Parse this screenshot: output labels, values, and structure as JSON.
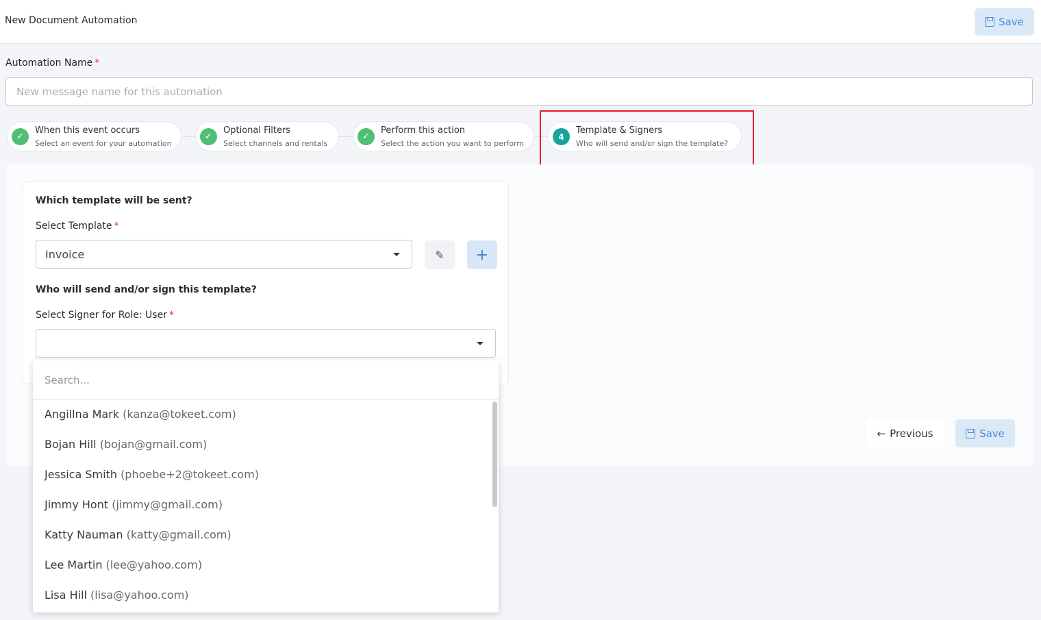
{
  "header": {
    "title": "New Document Automation",
    "save_label": "Save"
  },
  "automation_name": {
    "label": "Automation Name",
    "required_mark": "*",
    "placeholder": "New message name for this automation",
    "value": ""
  },
  "steps": [
    {
      "title": "When this event occurs",
      "subtitle": "Select an event for your automation",
      "status": "complete",
      "icon": "check-icon"
    },
    {
      "title": "Optional Filters",
      "subtitle": "Select channels and rentals",
      "status": "complete",
      "icon": "check-icon"
    },
    {
      "title": "Perform this action",
      "subtitle": "Select the action you want to perform",
      "status": "complete",
      "icon": "check-icon"
    },
    {
      "number": "4",
      "title": "Template & Signers",
      "subtitle": "Who will send and/or sign the template?",
      "status": "active"
    }
  ],
  "template_card": {
    "question": "Which template will be sent?",
    "select_label": "Select Template",
    "required_mark": "*",
    "selected_template": "Invoice",
    "signer_question": "Who will send and/or sign this template?",
    "signer_label": "Select Signer for Role: User",
    "signer_value": ""
  },
  "signer_dropdown": {
    "search_placeholder": "Search...",
    "options": [
      {
        "name": "Angillna Mark",
        "email": "(kanza@tokeet.com)"
      },
      {
        "name": "Bojan Hill",
        "email": "(bojan@gmail.com)"
      },
      {
        "name": "Jessica Smith",
        "email": "(phoebe+2@tokeet.com)"
      },
      {
        "name": "Jimmy Hont",
        "email": "(jimmy@gmail.com)"
      },
      {
        "name": "Katty Nauman",
        "email": "(katty@gmail.com)"
      },
      {
        "name": "Lee Martin",
        "email": "(lee@yahoo.com)"
      },
      {
        "name": "Lisa Hill",
        "email": "(lisa@yahoo.com)"
      }
    ]
  },
  "footer": {
    "previous_label": "Previous",
    "save_label": "Save"
  },
  "colors": {
    "accent": "#4a8ed6",
    "step_complete": "#4fbf73",
    "step_active": "#16a39a",
    "highlight": "#e02222",
    "required": "#e03131"
  }
}
